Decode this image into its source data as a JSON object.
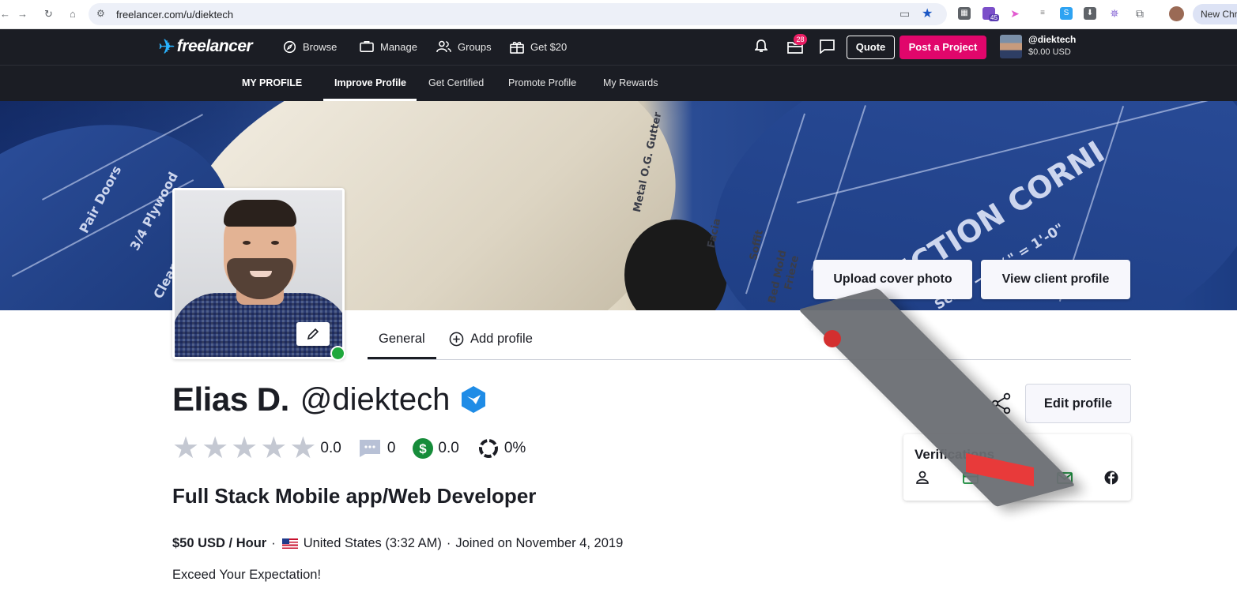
{
  "browser": {
    "url": "freelancer.com/u/diektech",
    "new_chrome_label": "New Chr",
    "extension_badge": "45"
  },
  "topnav": {
    "logo_text": "freelancer",
    "browse": "Browse",
    "manage": "Manage",
    "groups": "Groups",
    "get20": "Get $20",
    "notifications_count": "28",
    "quote": "Quote",
    "post_project": "Post a Project",
    "user_handle": "@diektech",
    "user_balance": "$0.00 USD"
  },
  "subnav": {
    "my_profile": "MY PROFILE",
    "improve_profile": "Improve Profile",
    "get_certified": "Get Certified",
    "promote_profile": "Promote Profile",
    "my_rewards": "My Rewards"
  },
  "cover": {
    "upload_cover": "Upload cover photo",
    "view_client": "View client profile",
    "blueprint_texts": [
      "ECTION CORNI",
      "Scale — 1½\" = 1'-0\"",
      "3/4 Plywood",
      "Pair Doors",
      "Metal O.G. Gutter",
      "Facia",
      "Soffit",
      "Bed Mold",
      "Frieze",
      "Clearance"
    ]
  },
  "tabs": {
    "general": "General",
    "add_profile": "Add profile"
  },
  "profile": {
    "name": "Elias D.",
    "handle": "@diektech",
    "rating": "0.0",
    "reviews": "0",
    "earnings": "0.0",
    "completion": "0%",
    "stars_filled": 0,
    "stars_total": 5,
    "title": "Full Stack Mobile app/Web Developer",
    "rate": "$50 USD / Hour",
    "location": "United States (3:32 AM)",
    "joined": "Joined on November 4, 2019",
    "tagline": "Exceed Your Expectation!"
  },
  "actions": {
    "edit_profile": "Edit profile"
  },
  "verifications": {
    "title": "Verifications"
  },
  "colors": {
    "brand_pink": "#e1066b",
    "nav_bg": "#1b1d24",
    "online_green": "#1fa83c",
    "verified_blue": "#1f8ce6",
    "earnings_green": "#168c3a"
  }
}
